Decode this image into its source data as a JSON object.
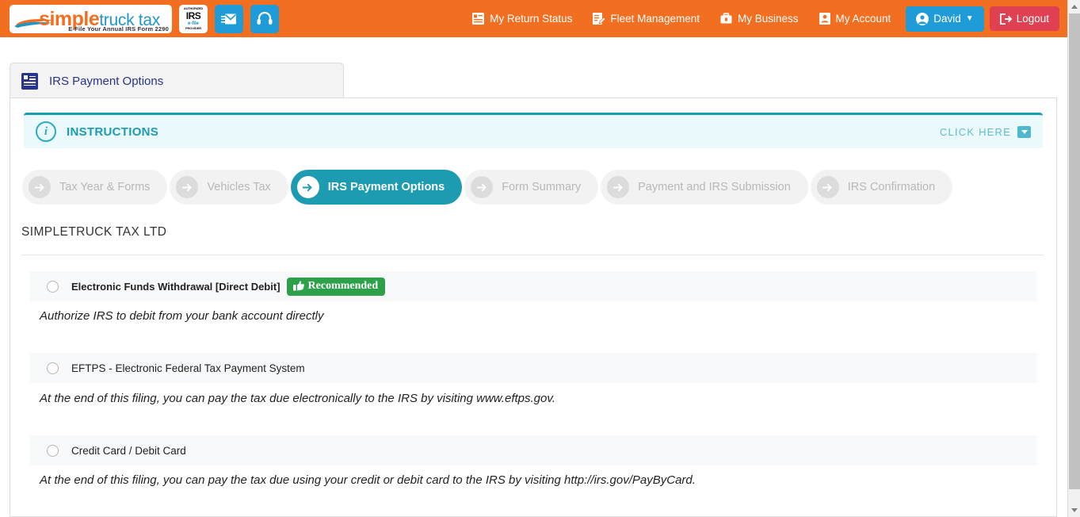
{
  "topbar": {
    "logo": {
      "simple": "simple",
      "truck_tax": "truck tax",
      "tagline": "E-File Your Annual IRS Form 2290"
    },
    "irs_badge": {
      "line1": "AUTHORIZED",
      "line2": "IRS",
      "line3": "e-file",
      "line4": "PROVIDER"
    },
    "mail_button": "envelope-icon",
    "support_button": "headset-icon",
    "nav_items": [
      {
        "label": "My Return Status",
        "icon": "list-card-icon"
      },
      {
        "label": "Fleet Management",
        "icon": "edit-document-icon"
      },
      {
        "label": "My Business",
        "icon": "briefcase-icon"
      },
      {
        "label": "My Account",
        "icon": "user-card-icon"
      }
    ],
    "user_button": {
      "label": "David",
      "icon": "user-circle-icon"
    },
    "logout_button": {
      "label": "Logout",
      "icon": "logout-icon"
    },
    "colors": {
      "bar": "#F26E21",
      "user_btn": "#1F9BD7",
      "logout_btn": "#E04152"
    }
  },
  "tab": {
    "label": "IRS Payment Options",
    "icon": "document-list-icon",
    "color": "#27348B"
  },
  "instructions": {
    "title": "INSTRUCTIONS",
    "icon": "info-icon",
    "click_here": "CLICK HERE",
    "caret": "chevron-down-icon",
    "accent": "#1D9BB0"
  },
  "stepper": {
    "active_index": 2,
    "active_color": "#1D9BB0",
    "steps": [
      {
        "label": "Tax Year & Forms",
        "active": false
      },
      {
        "label": "Vehicles Tax",
        "active": false
      },
      {
        "label": "IRS Payment Options",
        "active": true
      },
      {
        "label": "Form Summary",
        "active": false
      },
      {
        "label": "Payment and IRS Submission",
        "active": false
      },
      {
        "label": "IRS Confirmation",
        "active": false
      }
    ]
  },
  "main": {
    "company_name": "SIMPLETRUCK TAX LTD",
    "payment_options": [
      {
        "label": "Electronic Funds Withdrawal [Direct Debit]",
        "badge": "Recommended",
        "badge_icon": "thumbs-up-icon",
        "badge_color": "#2CA14A",
        "selected": false,
        "description": "Authorize IRS to debit from your bank account directly"
      },
      {
        "label": "EFTPS - Electronic Federal Tax Payment System",
        "badge": null,
        "selected": false,
        "description": "At the end of this filing, you can pay the tax due electronically to the IRS by visiting www.eftps.gov."
      },
      {
        "label": "Credit Card / Debit Card",
        "badge": null,
        "selected": false,
        "description": "At the end of this filing, you can pay the tax due using your credit or debit card to the IRS by visiting http://irs.gov/PayByCard."
      }
    ]
  },
  "scrollbar": {
    "up_arrow": "scroll-up-icon",
    "down_arrow": "scroll-down-icon"
  }
}
